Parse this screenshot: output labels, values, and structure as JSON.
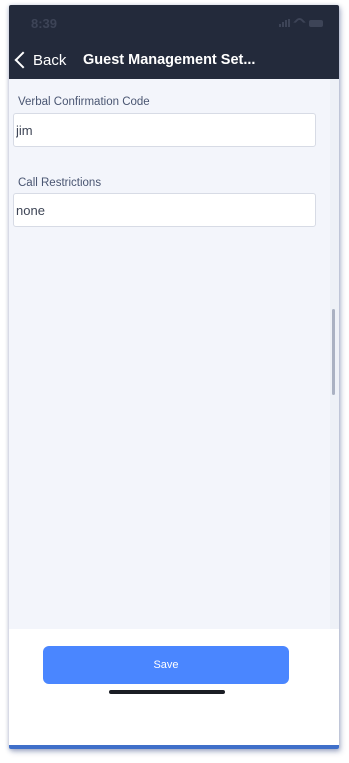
{
  "status_bar": {
    "time": "8:39"
  },
  "nav": {
    "back_label": "Back",
    "title": "Guest Management Set..."
  },
  "form": {
    "verbal_code": {
      "label": "Verbal Confirmation Code",
      "value": "jim"
    },
    "call_restrictions": {
      "label": "Call Restrictions",
      "value": "none"
    }
  },
  "footer": {
    "save_label": "Save"
  },
  "colors": {
    "header_bg": "#232a3b",
    "content_bg": "#f3f5fb",
    "accent": "#4a86ff"
  },
  "icons": [
    "signal-icon",
    "wifi-icon",
    "battery-icon",
    "chevron-left-icon"
  ]
}
